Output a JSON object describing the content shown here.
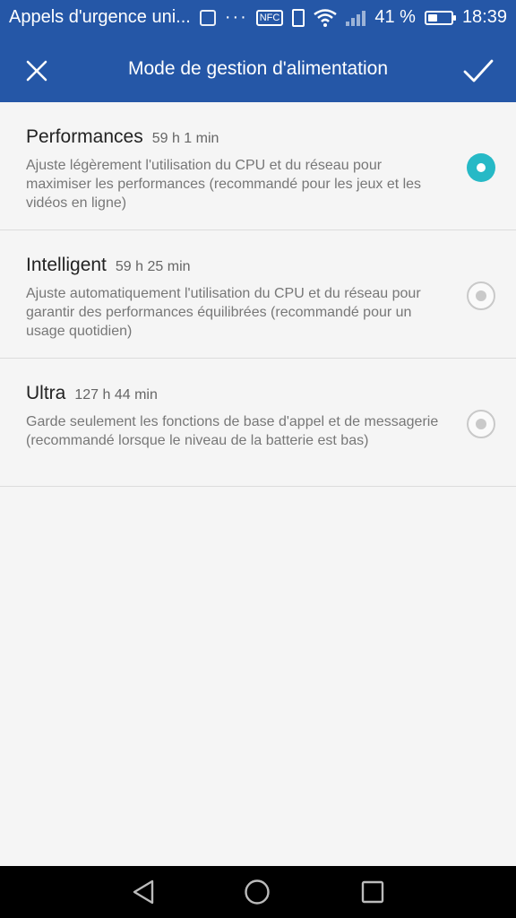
{
  "statusbar": {
    "carrier_text": "Appels d'urgence uni...",
    "battery_percent_text": "41 %",
    "battery_level": 0.41,
    "time": "18:39",
    "nfc_label": "NFC",
    "icons": [
      "medical-app-icon",
      "more-dots-icon",
      "nfc-icon",
      "vibrate-icon",
      "wifi-icon",
      "signal-icon",
      "battery-icon"
    ]
  },
  "appbar": {
    "title": "Mode de gestion d'alimentation",
    "close_icon": "close-icon",
    "confirm_icon": "check-icon"
  },
  "options": [
    {
      "title": "Performances",
      "duration": "59 h 1 min",
      "description": "Ajuste légèrement l'utilisation du CPU et du réseau pour maximiser les performances (recommandé pour les jeux et les vidéos en ligne)",
      "selected": true
    },
    {
      "title": "Intelligent",
      "duration": "59 h  25 min",
      "description": "Ajuste automatiquement l'utilisation du CPU et du réseau pour garantir des performances équilibrées (recommandé pour un usage quotidien)",
      "selected": false
    },
    {
      "title": "Ultra",
      "duration": "127 h  44 min",
      "description": "Garde seulement les fonctions de base d'appel et de messagerie (recommandé lorsque le niveau de la batterie est bas)",
      "selected": false
    }
  ],
  "colors": {
    "primary": "#2557a7",
    "accent": "#26b9c6",
    "background": "#f5f5f5"
  },
  "navbar": {
    "icons": [
      "back-icon",
      "home-icon",
      "recent-apps-icon"
    ]
  }
}
